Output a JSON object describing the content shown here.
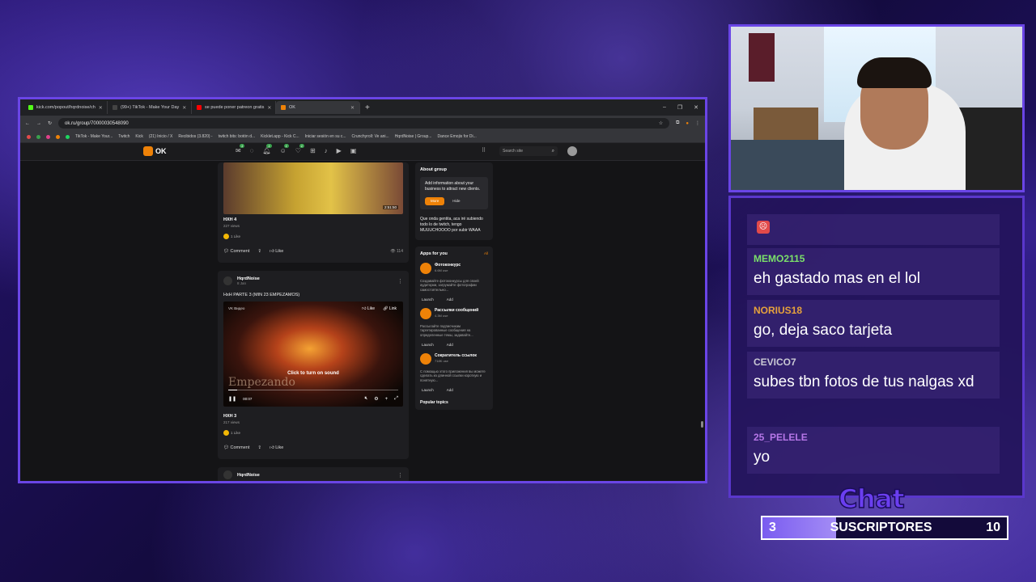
{
  "browser": {
    "tabs": [
      {
        "label": "kick.com/popout/hqrdnoise/ch",
        "color": "#53fc18",
        "active": false
      },
      {
        "label": "(99+) TikTok - Make Your Day",
        "color": "#111111",
        "active": false
      },
      {
        "label": "se puede poner patreon gratis",
        "color": "#ff0000",
        "active": false
      },
      {
        "label": "OK",
        "color": "#ee8208",
        "active": true
      }
    ],
    "new_tab": "+",
    "url": "ok.ru/group/70000030548090",
    "bookmarks": [
      "TikTok - Make Your...",
      "Twitch",
      "Kick",
      "(21) Inicio / X",
      "Recibidos (3.820) -",
      "twitch bits: botón d...",
      "Kicklet.app - Kick C...",
      "Iniciar sesión en su c...",
      "Crunchyroll: Ve ani...",
      "HqrdNoise | Group...",
      "Dance Emojis for Di..."
    ]
  },
  "ok": {
    "logo": "OK",
    "nav_badges": [
      "1",
      "1",
      "1",
      "1"
    ],
    "search_placeholder": "Search site",
    "post1": {
      "time": "2:51:50",
      "title": "HXH 4",
      "views": "227 views",
      "likes": "1 Like",
      "comment": "Comment",
      "like": "Like",
      "views_count": "114"
    },
    "post2": {
      "author": "HqrdNoise",
      "date": "8 Jan",
      "caption": "HxH PARTE 3 (MIN 23 EMPEZAMOS)",
      "vk": "VK Видео",
      "like_btn": "Like",
      "link_btn": "Link",
      "overlay": "Click to turn on sound",
      "watermark": "Empezando",
      "time": "00:07",
      "progress": 0.05,
      "title": "HXH 3",
      "views": "217 views",
      "likes": "1 Like",
      "comment": "Comment",
      "like": "Like"
    },
    "post3": {
      "author": "HqrdNoise"
    },
    "about": {
      "heading": "About group",
      "promo": "Add information about your business to attract new clients.",
      "more": "More",
      "hide": "Hide",
      "description": "Que onda gentita, aca iré subiendo todo lo de twitch, tengo MUUUCHOOOO por subir WAAA"
    },
    "apps": {
      "heading": "Apps for you",
      "all": "All",
      "launch": "Launch",
      "add": "Add",
      "items": [
        {
          "name": "Фотоконкурс",
          "users": "6.6M use",
          "desc": "Создавайте фотоконкурсы для своей аудитории, загружайте фотографии самостоятельно..."
        },
        {
          "name": "Рассылки сообщений",
          "users": "4.3M use",
          "desc": "Рассылайте подписчикам таргетированные сообщения на определенные темы, задавайте..."
        },
        {
          "name": "Сократитель ссылок",
          "users": "718K use",
          "desc": "С помощью этого приложения вы можете сделать из длинной ссылки короткую и понятную..."
        }
      ],
      "more_label": "Popular topics"
    }
  },
  "chat": {
    "messages": [
      {
        "user": "MEMO2115",
        "color": "#7be06a",
        "text": "eh gastado mas en el lol"
      },
      {
        "user": "NORIUS18",
        "color": "#e6a23c",
        "text": "go, deja saco tarjeta"
      },
      {
        "user": "CEVICO7",
        "color": "#c9c9d4",
        "text": "subes tbn fotos de tus nalgas xd"
      },
      {
        "user": "25_PELELE",
        "color": "#b676e8",
        "text": "yo"
      }
    ],
    "logo": "Chat"
  },
  "subs": {
    "current": "3",
    "label": "SUSCRIPTORES",
    "goal": "10",
    "progress": 0.3
  }
}
